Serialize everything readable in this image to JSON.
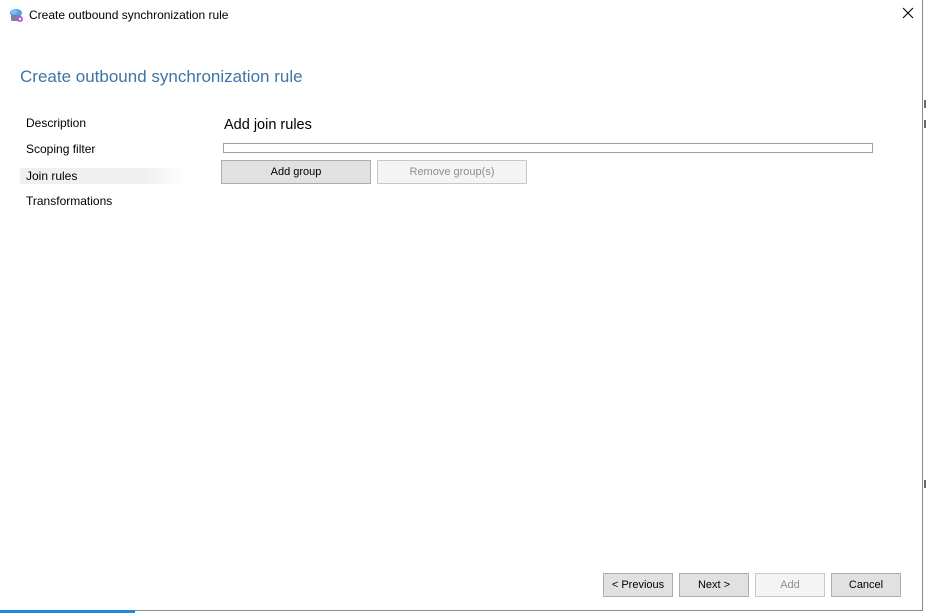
{
  "window": {
    "title": "Create outbound synchronization rule",
    "app_icon": "sync-service-icon",
    "close_icon": "close-icon"
  },
  "page": {
    "title": "Create outbound synchronization rule"
  },
  "nav": {
    "items": [
      {
        "label": "Description",
        "selected": false
      },
      {
        "label": "Scoping filter",
        "selected": false
      },
      {
        "label": "Join rules",
        "selected": true
      },
      {
        "label": "Transformations",
        "selected": false
      }
    ]
  },
  "join_rules": {
    "heading": "Add join rules",
    "add_group_label": "Add group",
    "remove_groups_label": "Remove group(s)"
  },
  "footer": {
    "previous_label": "< Previous",
    "next_label": "Next >",
    "add_label": "Add",
    "cancel_label": "Cancel"
  },
  "colors": {
    "title_blue": "#3e74a6",
    "selected_nav_bg": "#f0f0f0",
    "button_bg": "#e1e1e1",
    "disabled_text": "#8f8f8f"
  }
}
